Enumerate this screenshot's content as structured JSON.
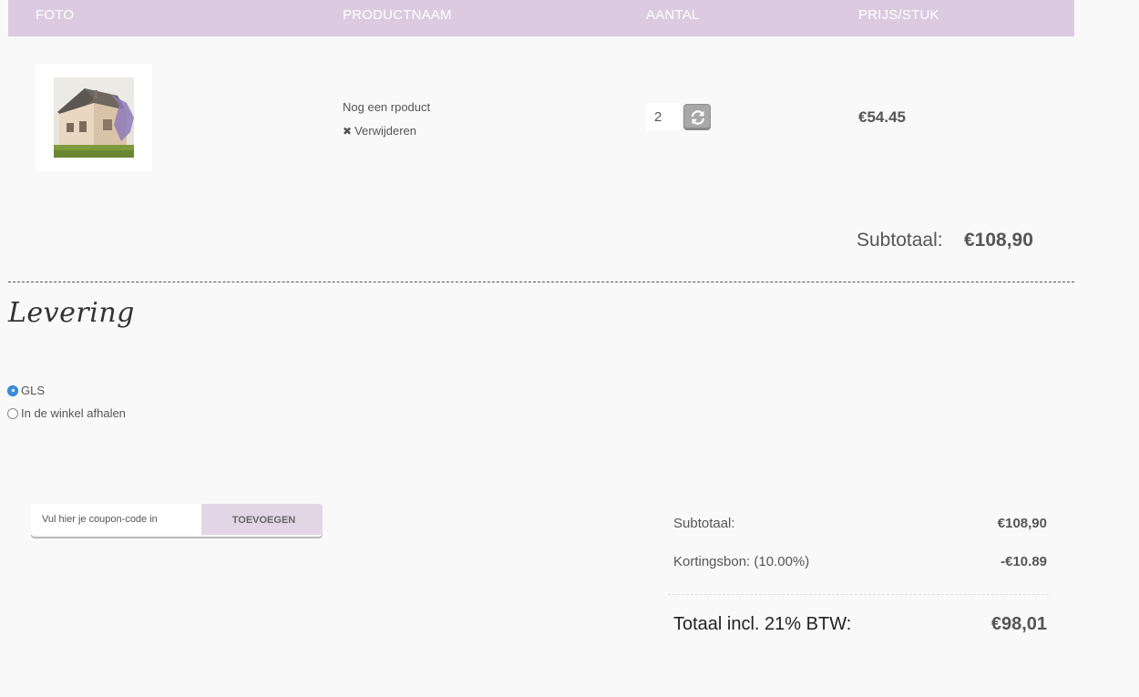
{
  "table_header": {
    "photo": "FOTO",
    "product_name": "PRODUCTNAAM",
    "quantity": "AANTAL",
    "unit_price": "PRIJS/STUK"
  },
  "cart_items": [
    {
      "name": "Nog een rpoduct",
      "remove_label": "Verwijderen",
      "quantity": "2",
      "unit_price": "€54.45"
    }
  ],
  "cart_subtotal": {
    "label": "Subtotaal:",
    "value": "€108,90"
  },
  "delivery": {
    "title": "Levering",
    "options": [
      {
        "label": "GLS",
        "selected": true
      },
      {
        "label": "In de winkel afhalen",
        "selected": false
      }
    ]
  },
  "coupon": {
    "placeholder": "Vul hier je coupon-code in",
    "button_label": "TOEVOEGEN"
  },
  "totals": {
    "subtotal_label": "Subtotaal:",
    "subtotal_value": "€108,90",
    "discount_label": "Kortingsbon: (10.00%)",
    "discount_value": "-€10.89",
    "grand_label": "Totaal incl. 21% BTW:",
    "grand_value": "€98,01"
  },
  "colors": {
    "header_bg": "#dccbe0",
    "coupon_button_bg": "#e2d6e6",
    "radio_selected": "#3b8ee0"
  },
  "icons": {
    "remove": "close-icon",
    "refresh": "refresh-icon"
  }
}
